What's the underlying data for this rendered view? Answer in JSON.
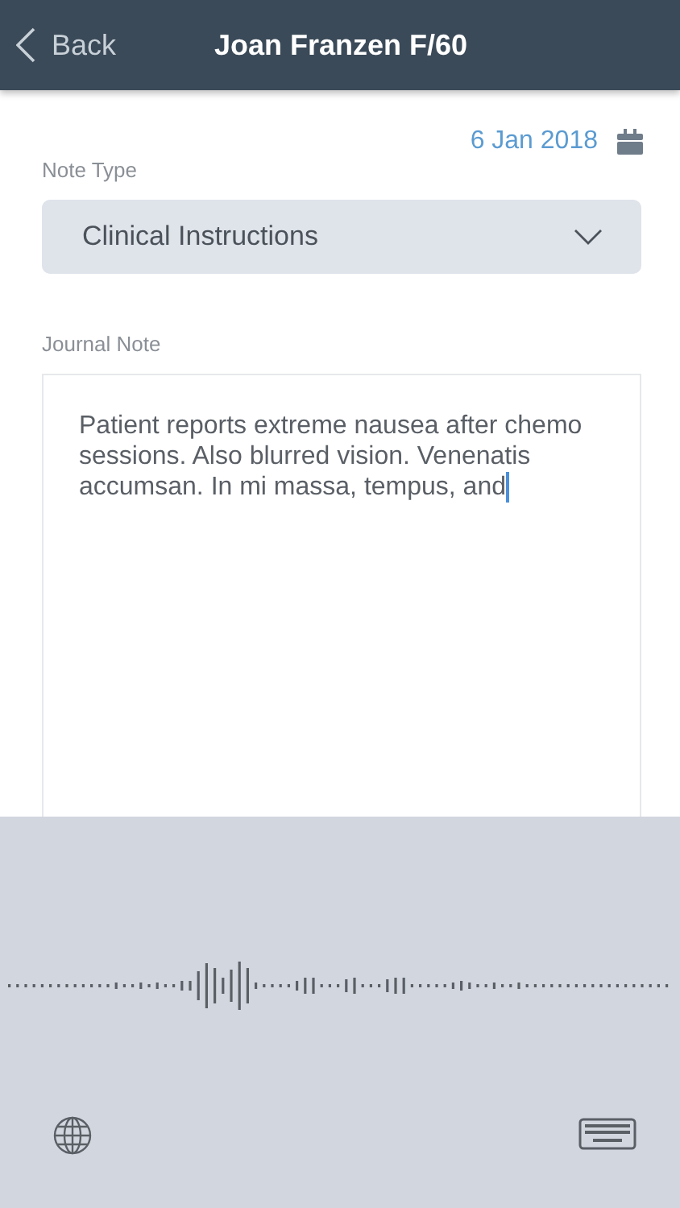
{
  "nav": {
    "back_label": "Back",
    "title": "Joan Franzen F/60"
  },
  "date": "6 Jan 2018",
  "note_type": {
    "label": "Note Type",
    "value": "Clinical Instructions"
  },
  "journal_note": {
    "label": "Journal Note",
    "value": "Patient reports extreme nausea after chemo sessions. Also blurred vision. Venenatis accumsan. In mi massa, tempus, and",
    "focused": true
  }
}
